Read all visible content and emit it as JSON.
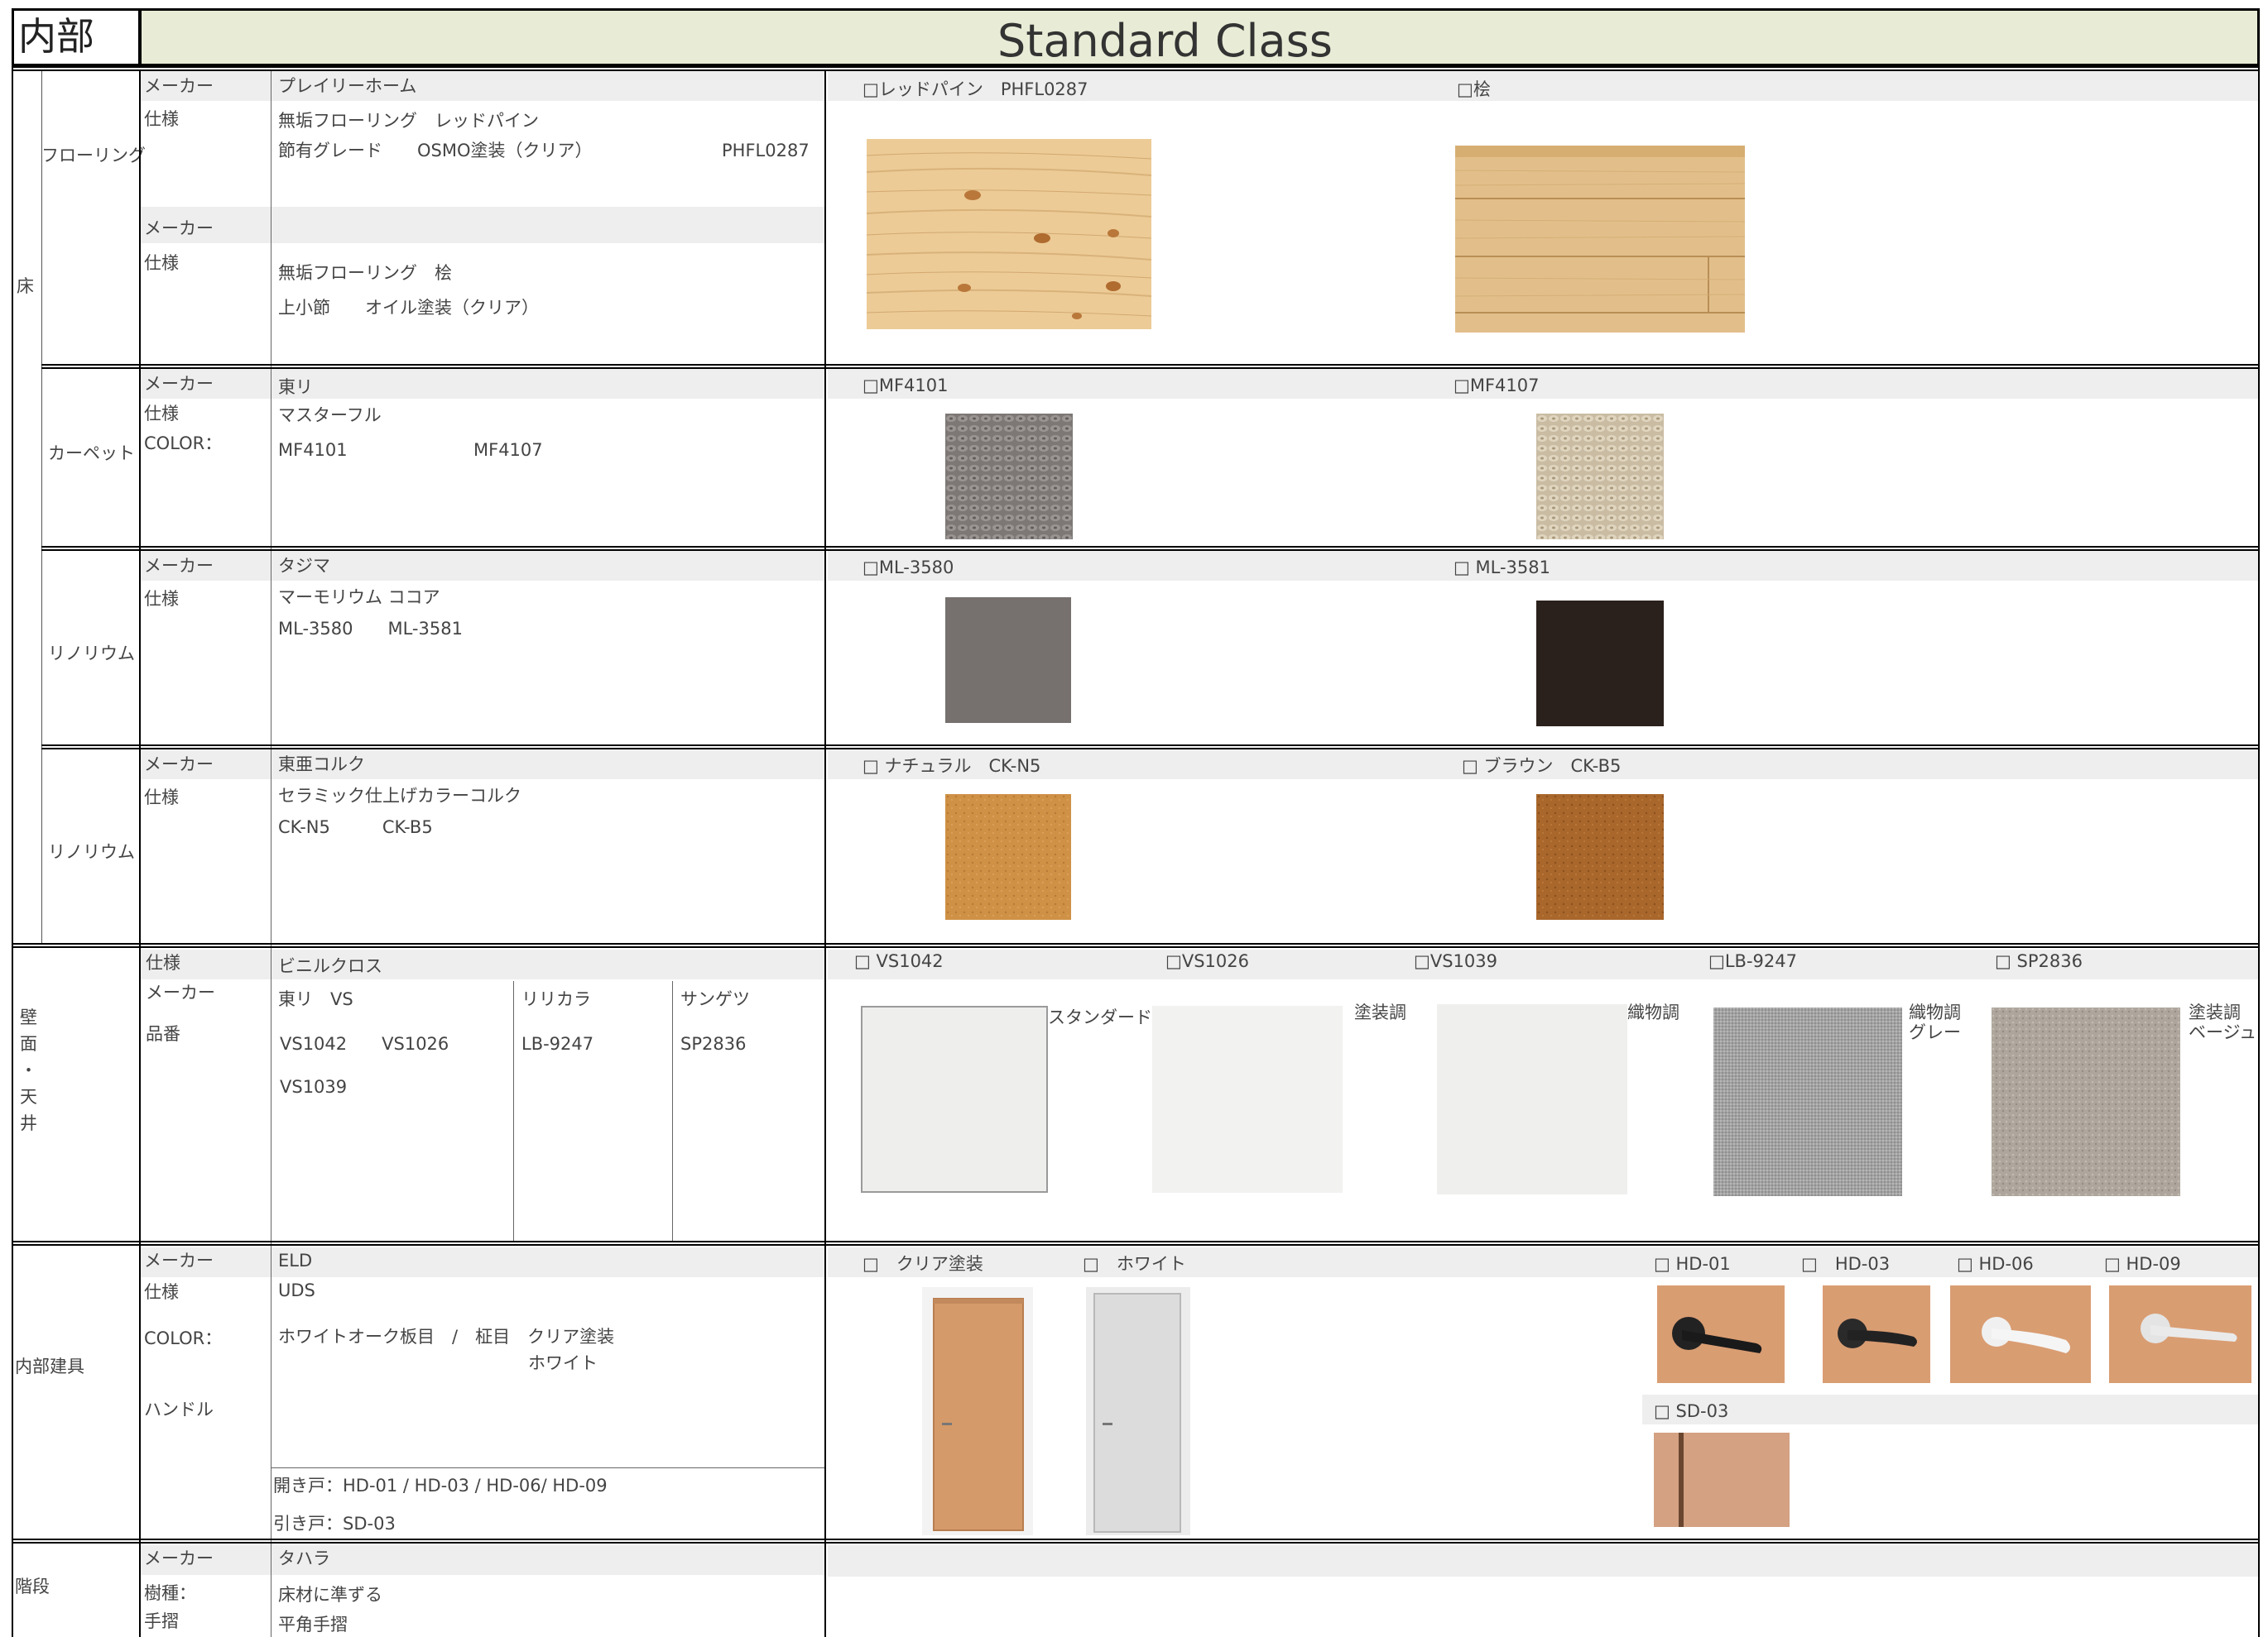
{
  "header": {
    "section": "内部",
    "title": "Standard Class"
  },
  "labels": {
    "maker": "メーカー",
    "spec": "仕様",
    "color": "COLOR：",
    "partno": "品番",
    "handle": "ハンドル",
    "species": "樹種：",
    "handrail": "手摺"
  },
  "floor": {
    "category": "床",
    "flooring": {
      "name": "フローリング",
      "maker1": "プレイリーホーム",
      "spec1_line1": "無垢フローリング　レッドパイン",
      "spec1_line2": "節有グレード　　OSMO塗装（クリア）",
      "spec1_code": "PHFL0287",
      "maker2": "",
      "spec2_line1": "無垢フローリング　桧",
      "spec2_line2": "上小節　　オイル塗装（クリア）",
      "sample1_label": "□レッドパイン　PHFL0287",
      "sample2_label": "□桧"
    },
    "carpet": {
      "name": "カーペット",
      "maker": "東リ",
      "spec": "マスターフル",
      "color1": "MF4101",
      "color2": "MF4107",
      "sample1_label": "□MF4101",
      "sample2_label": "□MF4107"
    },
    "linoleum": {
      "name": "リノリウム",
      "maker": "タジマ",
      "spec": "マーモリウム ココア",
      "codes": "ML-3580　　ML-3581",
      "sample1_label": "□ML-3580",
      "sample2_label": "□ ML-3581"
    },
    "cork": {
      "name": "リノリウム",
      "maker": "東亜コルク",
      "spec": "セラミック仕上げカラーコルク",
      "codes": "CK-N5　　　CK-B5",
      "sample1_label": "□ ナチュラル　CK-N5",
      "sample2_label": "□ ブラウン　CK-B5"
    }
  },
  "wall": {
    "category_chars": [
      "壁",
      "面",
      "・",
      "天",
      "井"
    ],
    "spec": "ビニルクロス",
    "maker_a": "東リ　VS",
    "maker_b": "リリカラ",
    "maker_c": "サンゲツ",
    "codes_a1": "VS1042　　VS1026",
    "codes_a2": "VS1039",
    "code_b": "LB-9247",
    "code_c": "SP2836",
    "samples": [
      {
        "label": "□ VS1042",
        "desc": "スタンダード",
        "color": "#eeeeec"
      },
      {
        "label": "□VS1026",
        "desc": "塗装調",
        "color": "#f2f2f0"
      },
      {
        "label": "□VS1039",
        "desc": "織物調",
        "color": "#efefee"
      },
      {
        "label": "□LB-9247",
        "desc": "織物調\nグレー",
        "color": "#a5a5a5"
      },
      {
        "label": "□ SP2836",
        "desc": "塗装調\nベージュ",
        "color": "#aea69c"
      }
    ]
  },
  "doors": {
    "category": "内部建具",
    "maker": "ELD",
    "spec": "UDS",
    "color_line1": "ホワイトオーク板目　/　柾目　クリア塗装",
    "color_line2": "ホワイト",
    "open_door": "開き戸：HD-01 / HD-03 / HD-06/ HD-09",
    "sliding_door": "引き戸：SD-03",
    "door1_label": "□　クリア塗装",
    "door2_label": "□　ホワイト",
    "handles": [
      "□ HD-01",
      "□　HD-03",
      "□ HD-06",
      "□ HD-09"
    ],
    "sliding_label": "□ SD-03"
  },
  "stairs": {
    "category": "階段",
    "maker": "タハラ",
    "species": "床材に準ずる",
    "handrail": "平角手摺"
  },
  "colors": {
    "header_bg": "#e8ecd6",
    "highlight": "#eeeeee",
    "wood_light": "#e8c690",
    "cork_natural": "#cf9146",
    "cork_brown": "#a9672c"
  }
}
